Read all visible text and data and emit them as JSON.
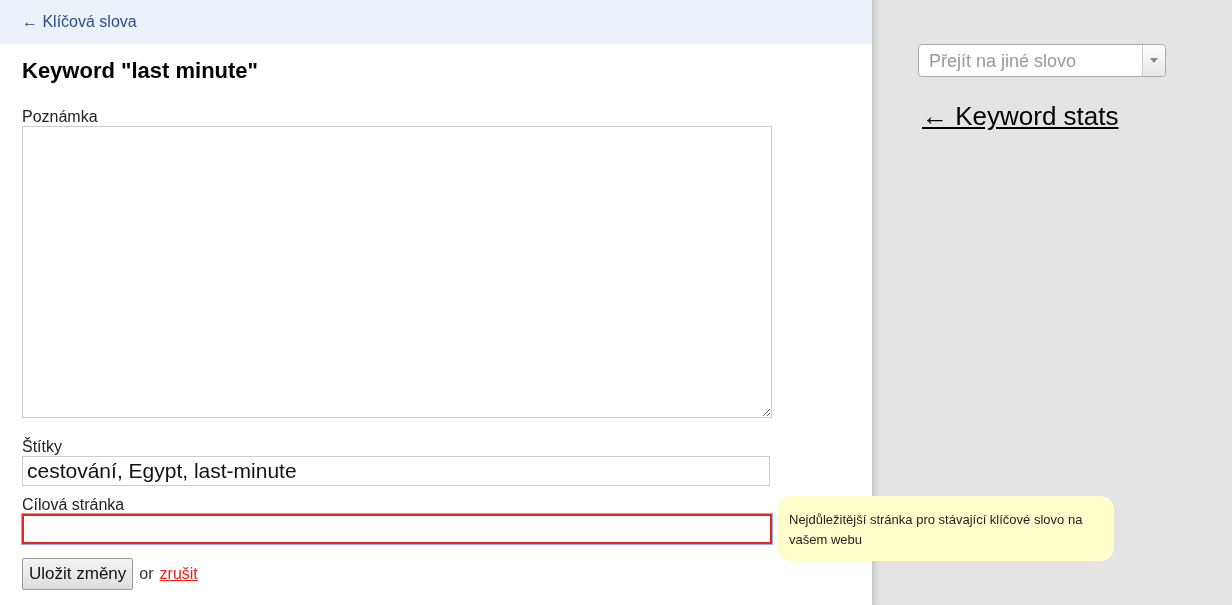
{
  "back_link": "← Klíčová slova",
  "title": "Keyword \"last minute\"",
  "fields": [
    {
      "kind": "textarea",
      "label": "Poznámka",
      "invalid": false
    },
    {
      "kind": "text",
      "label": "Štítky",
      "value": "cestování, Egypt, last-minute",
      "invalid": false
    },
    {
      "kind": "text",
      "label": "Cílová stránka",
      "invalid": true
    }
  ],
  "save_button": "Uložit změny",
  "or_text": "or",
  "cancel_link": "zrušit",
  "tooltip": "Nejdůležitější stránka pro stávající klíčové slovo na vašem webu",
  "sidebar": {
    "select": {
      "placeholder": "Přejít na jiné slovo"
    },
    "stats_link": "← Keyword stats"
  }
}
